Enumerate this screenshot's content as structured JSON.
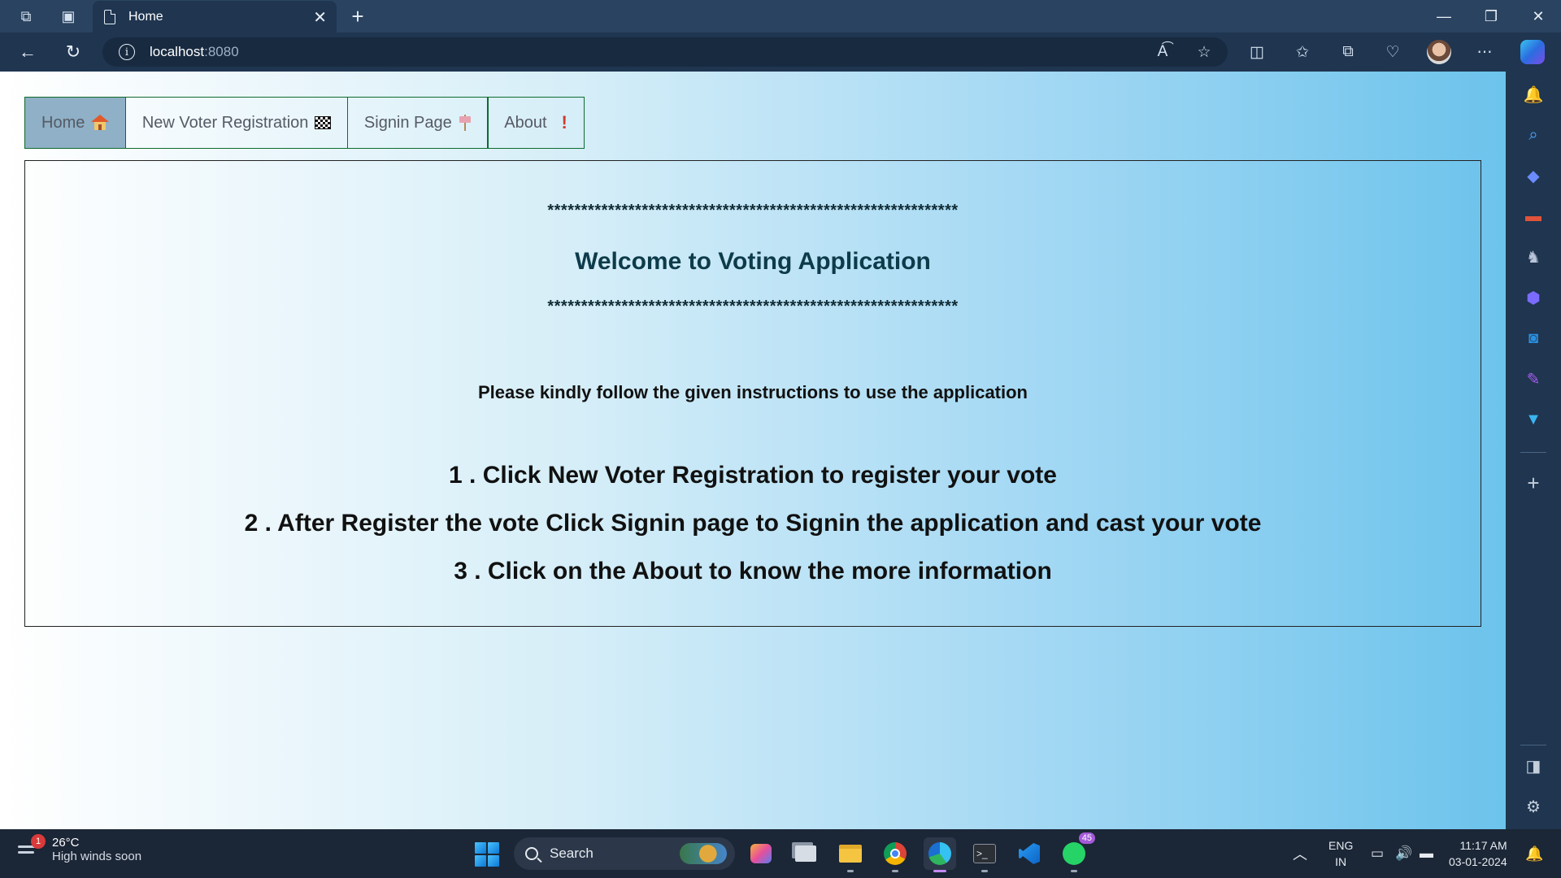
{
  "browser": {
    "tab_title": "Home",
    "url_host": "localhost",
    "url_port": ":8080"
  },
  "nav": {
    "items": [
      {
        "label": "Home"
      },
      {
        "label": "New Voter Registration"
      },
      {
        "label": "Signin Page"
      },
      {
        "label": "About"
      }
    ],
    "about_emoji": "!"
  },
  "content": {
    "stars_top": "*************************************************************",
    "welcome": "Welcome to Voting Application",
    "stars_bottom": "*************************************************************",
    "instruction_heading": "Please kindly follow the given instructions to use the application",
    "steps": [
      "1 . Click New Voter Registration to register your vote",
      "2 . After Register the vote Click Signin page to Signin the application and cast your vote",
      "3 . Click on the About to know the more information"
    ]
  },
  "taskbar": {
    "weather_temp": "26°C",
    "weather_desc": "High winds soon",
    "weather_badge": "1",
    "search_label": "Search",
    "whatsapp_badge": "45",
    "lang_top": "ENG",
    "lang_bottom": "IN",
    "time": "11:17 AM",
    "date": "03-01-2024"
  },
  "colors": {
    "nav_border": "#0e6b2e",
    "nav_active_bg": "#8fb0c6",
    "welcome_text": "#0d3b4a"
  }
}
